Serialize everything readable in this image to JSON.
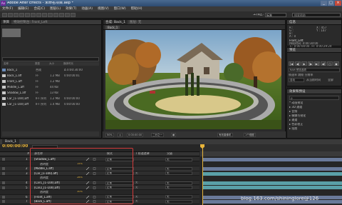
{
  "window": {
    "title": "Adobe After Effects - 未命名项目.aep *",
    "controls": [
      "_",
      "□",
      "×"
    ]
  },
  "menu": [
    "文件(F)",
    "编辑(E)",
    "合成(C)",
    "图层(L)",
    "效果(T)",
    "动画(A)",
    "视图(V)",
    "窗口(W)",
    "帮助(H)"
  ],
  "toolbar": {
    "workspace_label": "工作区:",
    "workspace_value": "标准",
    "search_placeholder": "搜索帮助"
  },
  "project_panel": {
    "tab": "项目",
    "tab2": "特效控制台: Front_Left",
    "header": [
      "名称",
      "类型",
      "大小",
      "媒体时长"
    ],
    "items": [
      {
        "name": "Back_1",
        "type": "合成",
        "size": "",
        "duration": "Δ 0:00:30:00",
        "color": "#6a8ab8"
      },
      {
        "name": "Back_L.aff",
        "type": "FF",
        "size": "1.2 MB",
        "duration": "0:00:00:01",
        "color": "#c8c8c8"
      },
      {
        "name": "Front_L.aff",
        "type": "FF",
        "size": "1.2 MB",
        "duration": "",
        "color": "#c8c8c8"
      },
      {
        "name": "Middle_L.aff",
        "type": "FF",
        "size": "44 KB",
        "duration": "",
        "color": "#c8c8c8"
      },
      {
        "name": "Shadow_L.aff",
        "type": "FF",
        "size": "13 KB",
        "duration": "",
        "color": "#c8c8c8"
      },
      {
        "name": "Car_[1-100].aff",
        "type": "IFF 序列",
        "size": "1.2 MB",
        "duration": "0:00:00:00",
        "color": "#c8c8c8"
      },
      {
        "name": "Car_[1-100].aff",
        "type": "IFF 序列",
        "size": "1.4 MB",
        "duration": "0:00:00:00",
        "color": "#c8c8c8"
      }
    ]
  },
  "comp_panel": {
    "tab": "合成: Back_1",
    "tab2": "图层: 无",
    "sub_tab": "Back_1",
    "bottom": {
      "zoom": "50%",
      "time": "0:00:00:00",
      "res": "二分之一",
      "view": "有效摄像机",
      "views": "1个视图"
    }
  },
  "info_panel": {
    "tab": "信息",
    "lines": [
      "R :",
      "G :",
      "B :",
      "A : 0"
    ],
    "coords": [
      "X : 457",
      "Y : 147"
    ],
    "layer_name": "Front_Left",
    "lines2": [
      "持续时间: 0:00:30:00",
      "入: 0:00:00:00, 出: 0:00:29:24"
    ]
  },
  "preview_panel": {
    "tab": "预览",
    "controls": [
      "|◀",
      "◀|",
      "▶",
      "|▶",
      "▶|",
      "◀)",
      "○",
      "▣"
    ],
    "options": [
      "RAM 预览选项",
      "帧速率 跳帧 分辨率",
      "自动",
      "从当前时间",
      "全屏"
    ]
  },
  "effects_panel": {
    "tab": "效果和预设",
    "search_placeholder": "ρ",
    "items": [
      "* 动画预设",
      "▸ 3D 通道",
      "▸ 音频",
      "▸ 模糊与锐化",
      "▸ 通道",
      "▸ 色彩校正",
      "▸ 扭曲"
    ]
  },
  "timeline": {
    "tab": "Back_1",
    "time": "0:00:00:00",
    "headers": {
      "num": "#",
      "name": "源名称",
      "mode": "模式",
      "trkmat": "T 轨道遮罩",
      "parent": "父级"
    },
    "layers": [
      {
        "num": "1",
        "name": "[Shadow_L.aff]",
        "mode": "正常",
        "trk": "",
        "parent": "无",
        "pct": "",
        "bar": "#6a7a9a"
      },
      {
        "num": "",
        "name": "透明度",
        "mode": "",
        "trk": "",
        "parent": "",
        "pct": "15%",
        "bar": ""
      },
      {
        "num": "2",
        "name": "[Middle_L.aff]",
        "mode": "正常",
        "trk": "",
        "parent": "无",
        "pct": "",
        "bar": "#6a7a9a"
      },
      {
        "num": "3",
        "name": "[Car_[1-100].aff]",
        "mode": "正常",
        "trk": "无",
        "parent": "无",
        "pct": "",
        "bar": "#5aa0a8"
      },
      {
        "num": "",
        "name": "透明度",
        "mode": "",
        "trk": "",
        "parent": "",
        "pct": "28%",
        "bar": ""
      },
      {
        "num": "4",
        "name": "[Car1_[1-100].aff]",
        "mode": "正常",
        "trk": "无",
        "parent": "无",
        "pct": "",
        "bar": "#5aa0a8"
      },
      {
        "num": "5",
        "name": "[Car2_[1-100].aff]",
        "mode": "正常",
        "trk": "无",
        "parent": "无",
        "pct": "",
        "bar": "#5aa0a8"
      },
      {
        "num": "",
        "name": "透明度",
        "mode": "",
        "trk": "",
        "parent": "",
        "pct": "30%",
        "bar": ""
      },
      {
        "num": "6",
        "name": "[Front_L.aff]",
        "mode": "正常",
        "trk": "无",
        "parent": "无",
        "pct": "",
        "bar": "#6a7a9a"
      },
      {
        "num": "7",
        "name": "[Back_L.aff]",
        "mode": "正常",
        "trk": "无",
        "parent": "无",
        "pct": "",
        "bar": "#6a7a9a"
      }
    ]
  },
  "watermark": "blog.163.com/shininglore@126"
}
